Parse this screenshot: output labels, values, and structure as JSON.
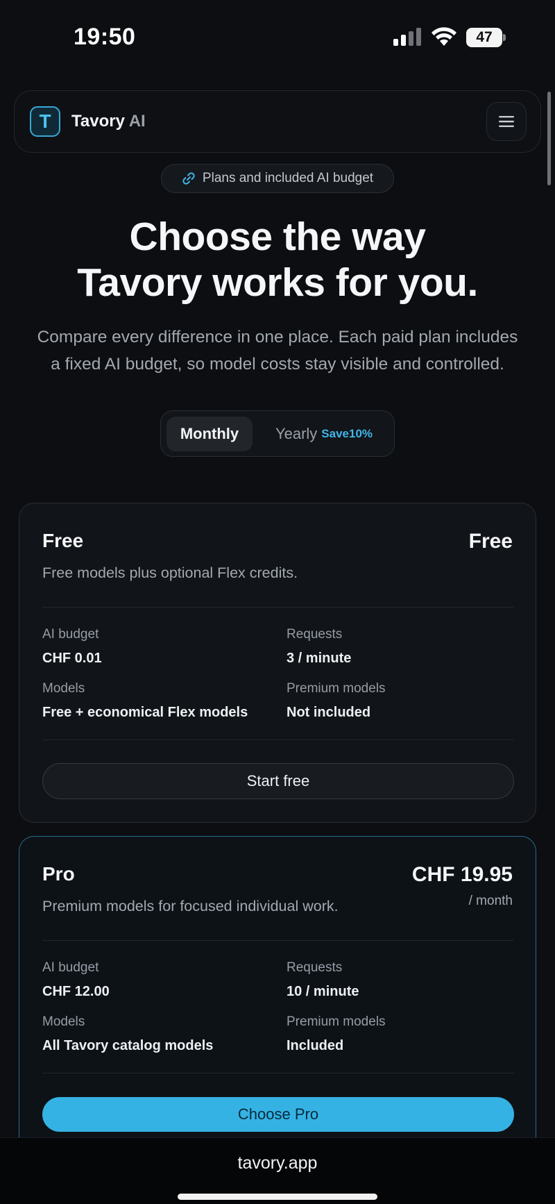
{
  "status_bar": {
    "time": "19:50",
    "battery": "47"
  },
  "header": {
    "brand_name": "Tavory",
    "brand_suffix": "AI",
    "logo_letter": "T"
  },
  "badge": {
    "label": "Plans and included AI budget"
  },
  "hero": {
    "title_line1": "Choose the way",
    "title_line2": "Tavory works for you.",
    "subtitle_line1": "Compare every difference in one place. Each paid plan includes",
    "subtitle_line2": "a fixed AI budget, so model costs stay visible and controlled."
  },
  "billing_toggle": {
    "monthly": "Monthly",
    "yearly": "Yearly",
    "save": "Save10%",
    "selected": "Monthly"
  },
  "plans": [
    {
      "name": "Free",
      "price": "Free",
      "description": "Free models plus optional Flex credits.",
      "ai_budget_label": "AI budget",
      "ai_budget": "CHF 0.01",
      "requests_label": "Requests",
      "requests": "3 / minute",
      "models_label": "Models",
      "models": "Free + economical Flex models",
      "premium_label": "Premium models",
      "premium": "Not included",
      "cta": "Start free"
    },
    {
      "name": "Pro",
      "price": "CHF 19.95",
      "period": "/ month",
      "description": "Premium models for focused individual work.",
      "ai_budget_label": "AI budget",
      "ai_budget": "CHF 12.00",
      "requests_label": "Requests",
      "requests": "10 / minute",
      "models_label": "Models",
      "models": "All Tavory catalog models",
      "premium_label": "Premium models",
      "premium": "Included",
      "cta": "Choose Pro"
    }
  ],
  "browser": {
    "url": "tavory.app"
  },
  "colors": {
    "accent": "#35b2e4",
    "background": "#0c0e11"
  }
}
